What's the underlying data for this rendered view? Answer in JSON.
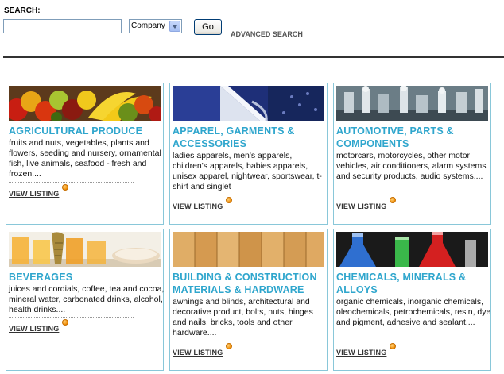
{
  "search": {
    "label": "SEARCH:",
    "value": "",
    "select_value": "Company",
    "go_label": "Go",
    "advanced_label": "ADVANCED SEARCH"
  },
  "categories": [
    {
      "title": "AGRICULTURAL PRODUCE",
      "description": "fruits and nuts, vegetables, plants and flowers, seeding and nursery, ornamental fish, live animals, seafood - fresh and frozen....",
      "link": "VIEW LISTING",
      "image": "fruit-basket-image"
    },
    {
      "title": "APPAREL, GARMENTS & ACCESSORIES",
      "description": "ladies apparels, men's apparels, children's apparels, babies apparels, unisex apparel, nightwear, sportswear, t-shirt and singlet",
      "link": "VIEW LISTING",
      "image": "dress-shirt-image"
    },
    {
      "title": "AUTOMOTIVE, PARTS & COMPONENTS",
      "description": "motorcars, motorcycles, other motor vehicles, air conditioners, alarm systems and security products, audio systems....",
      "link": "VIEW LISTING",
      "image": "engine-parts-image"
    },
    {
      "title": "BEVERAGES",
      "description": "juices and cordials, coffee, tea and cocoa, mineral water, carbonated drinks, alcohol, health drinks....",
      "link": "VIEW LISTING",
      "image": "juice-glasses-image"
    },
    {
      "title": "BUILDING & CONSTRUCTION MATERIALS & HARDWARE",
      "description": "awnings and blinds, architectural and decorative product, bolts, nuts, hinges and nails, bricks, tools and other hardware....",
      "link": "VIEW LISTING",
      "image": "wood-planks-image"
    },
    {
      "title": "CHEMICALS, MINERALS & ALLOYS",
      "description": "organic chemicals, inorganic chemicals, oleochemicals, petrochemicals, resin, dye and pigment, adhesive and sealant....",
      "link": "VIEW LISTING",
      "image": "chemical-flasks-image"
    }
  ]
}
